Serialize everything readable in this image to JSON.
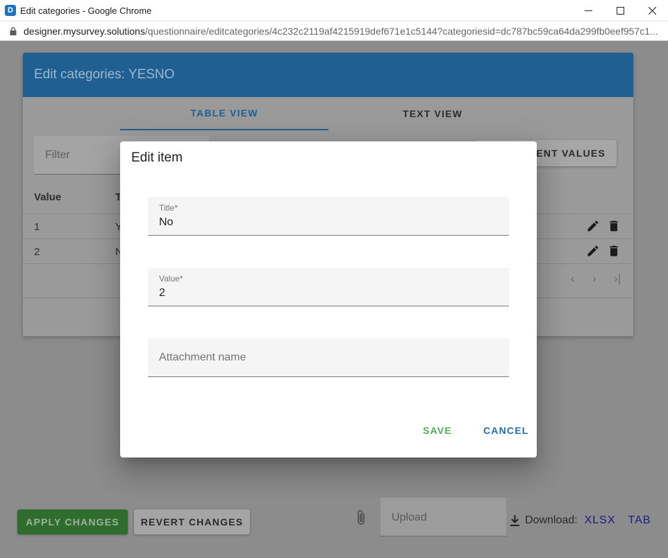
{
  "window": {
    "app_icon_letter": "D",
    "title": "Edit categories - Google Chrome",
    "url_host": "designer.mysurvey.solutions",
    "url_path": "/questionnaire/editcategories/4c232c2119af4215919def671e1c5144?categoriesid=dc787bc59ca64da299fb0eef957c1..."
  },
  "categories": {
    "header_title": "Edit categories: YESNO",
    "tabs": [
      {
        "label": "TABLE VIEW",
        "active": true
      },
      {
        "label": "TEXT VIEW",
        "active": false
      }
    ],
    "filter_placeholder": "Filter",
    "revert_values_label": "RENT VALUES",
    "columns": [
      "Value",
      "T"
    ],
    "rows": [
      {
        "value": "1",
        "title": "Y"
      },
      {
        "value": "2",
        "title": "N"
      }
    ],
    "pager": {
      "prev": "‹",
      "next": "›",
      "last": "›|"
    }
  },
  "bottom": {
    "apply_label": "APPLY CHANGES",
    "revert_label": "REVERT CHANGES",
    "upload_placeholder": "Upload",
    "download_label": "Download:",
    "xlsx_link": "XLSX",
    "tab_link": "TAB"
  },
  "dialog": {
    "title": "Edit item",
    "fields": [
      {
        "label": "Title*",
        "value": "No"
      },
      {
        "label": "Value*",
        "value": "2"
      },
      {
        "placeholder": "Attachment name"
      }
    ],
    "save_label": "SAVE",
    "cancel_label": "CANCEL"
  },
  "colors": {
    "primary": "#1e73be",
    "success": "#4caf50"
  }
}
